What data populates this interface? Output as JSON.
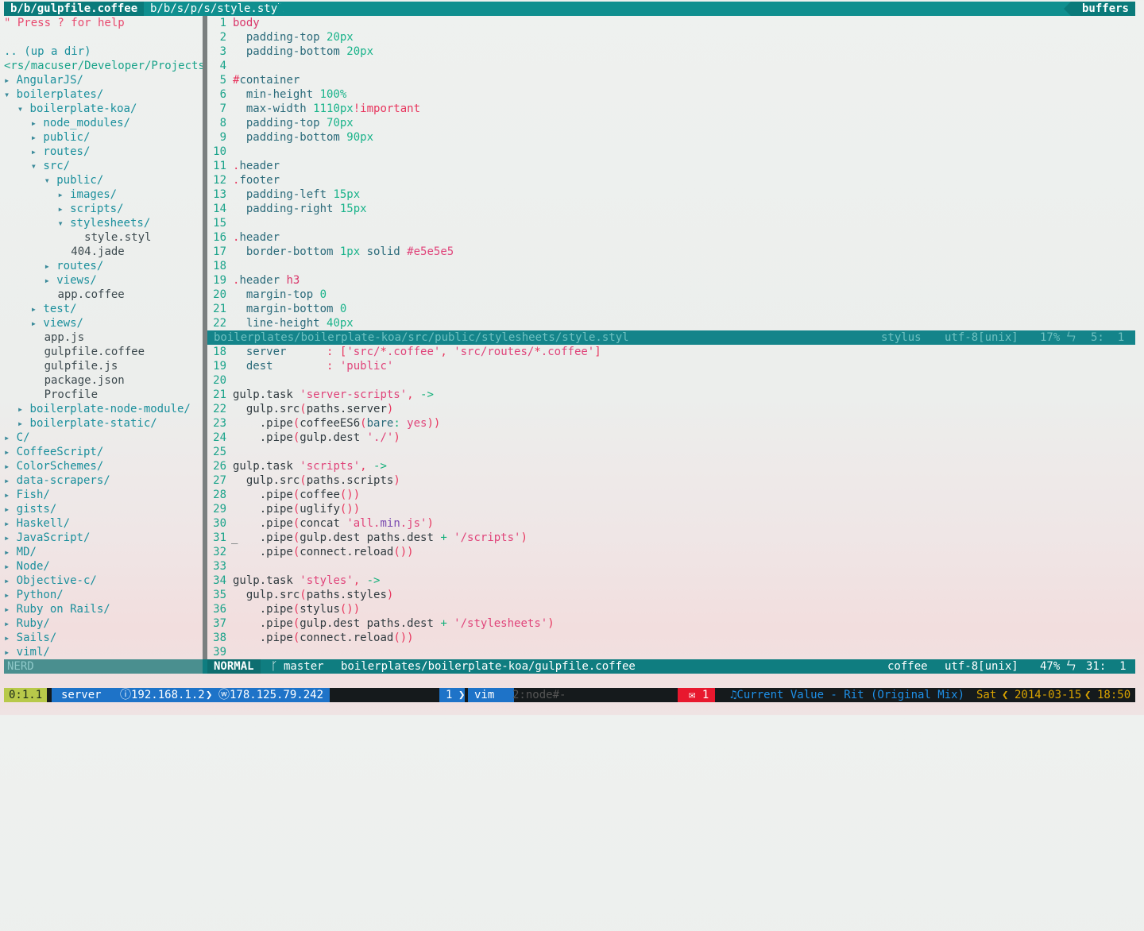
{
  "tabline": {
    "tabs": [
      {
        "label": "b/b/gulpfile.coffee",
        "active": true
      },
      {
        "label": "b/b/s/p/s/style.styl",
        "active": false
      }
    ],
    "buffers_label": "buffers"
  },
  "nerdtree": {
    "help": "\" Press ? for help",
    "up": ".. (up a dir)",
    "cwd": "<rs/macuser/Developer/Projects/",
    "entries": [
      {
        "indent": 0,
        "type": "dir-closed",
        "name": "AngularJS/"
      },
      {
        "indent": 0,
        "type": "dir-open",
        "name": "boilerplates/"
      },
      {
        "indent": 1,
        "type": "dir-open",
        "name": "boilerplate-koa/"
      },
      {
        "indent": 2,
        "type": "dir-closed",
        "name": "node_modules/"
      },
      {
        "indent": 2,
        "type": "dir-closed",
        "name": "public/"
      },
      {
        "indent": 2,
        "type": "dir-closed",
        "name": "routes/"
      },
      {
        "indent": 2,
        "type": "dir-open",
        "name": "src/"
      },
      {
        "indent": 3,
        "type": "dir-open",
        "name": "public/"
      },
      {
        "indent": 4,
        "type": "dir-closed",
        "name": "images/"
      },
      {
        "indent": 4,
        "type": "dir-closed",
        "name": "scripts/"
      },
      {
        "indent": 4,
        "type": "dir-open",
        "name": "stylesheets/"
      },
      {
        "indent": 6,
        "type": "file",
        "name": "style.styl"
      },
      {
        "indent": 5,
        "type": "file",
        "name": "404.jade"
      },
      {
        "indent": 3,
        "type": "dir-closed",
        "name": "routes/"
      },
      {
        "indent": 3,
        "type": "dir-closed",
        "name": "views/"
      },
      {
        "indent": 4,
        "type": "file",
        "name": "app.coffee"
      },
      {
        "indent": 2,
        "type": "dir-closed",
        "name": "test/"
      },
      {
        "indent": 2,
        "type": "dir-closed",
        "name": "views/"
      },
      {
        "indent": 3,
        "type": "file",
        "name": "app.js"
      },
      {
        "indent": 3,
        "type": "file",
        "name": "gulpfile.coffee"
      },
      {
        "indent": 3,
        "type": "file",
        "name": "gulpfile.js"
      },
      {
        "indent": 3,
        "type": "file",
        "name": "package.json"
      },
      {
        "indent": 3,
        "type": "file",
        "name": "Procfile"
      },
      {
        "indent": 1,
        "type": "dir-closed",
        "name": "boilerplate-node-module/"
      },
      {
        "indent": 1,
        "type": "dir-closed",
        "name": "boilerplate-static/"
      },
      {
        "indent": 0,
        "type": "dir-closed",
        "name": "C/"
      },
      {
        "indent": 0,
        "type": "dir-closed",
        "name": "CoffeeScript/"
      },
      {
        "indent": 0,
        "type": "dir-closed",
        "name": "ColorSchemes/"
      },
      {
        "indent": 0,
        "type": "dir-closed",
        "name": "data-scrapers/"
      },
      {
        "indent": 0,
        "type": "dir-closed",
        "name": "Fish/"
      },
      {
        "indent": 0,
        "type": "dir-closed",
        "name": "gists/"
      },
      {
        "indent": 0,
        "type": "dir-closed",
        "name": "Haskell/"
      },
      {
        "indent": 0,
        "type": "dir-closed",
        "name": "JavaScript/"
      },
      {
        "indent": 0,
        "type": "dir-closed",
        "name": "MD/"
      },
      {
        "indent": 0,
        "type": "dir-closed",
        "name": "Node/"
      },
      {
        "indent": 0,
        "type": "dir-closed",
        "name": "Objective-c/"
      },
      {
        "indent": 0,
        "type": "dir-closed",
        "name": "Python/"
      },
      {
        "indent": 0,
        "type": "dir-closed",
        "name": "Ruby on Rails/"
      },
      {
        "indent": 0,
        "type": "dir-closed",
        "name": "Ruby/"
      },
      {
        "indent": 0,
        "type": "dir-closed",
        "name": "Sails/"
      },
      {
        "indent": 0,
        "type": "dir-closed",
        "name": "viml/"
      }
    ],
    "status_label": "NERD"
  },
  "editor_top": {
    "lines": [
      {
        "n": "1",
        "tokens": [
          [
            "sel",
            "body"
          ]
        ]
      },
      {
        "n": "2",
        "tokens": [
          [
            "txt",
            "  "
          ],
          [
            "kw",
            "padding-top "
          ],
          [
            "num",
            "20px"
          ]
        ]
      },
      {
        "n": "3",
        "tokens": [
          [
            "txt",
            "  "
          ],
          [
            "kw",
            "padding-bottom "
          ],
          [
            "num",
            "20px"
          ]
        ]
      },
      {
        "n": "4",
        "tokens": []
      },
      {
        "n": "5",
        "tokens": [
          [
            "red",
            "#"
          ],
          [
            "kw",
            "container"
          ]
        ]
      },
      {
        "n": "6",
        "tokens": [
          [
            "txt",
            "  "
          ],
          [
            "kw",
            "min-height "
          ],
          [
            "num",
            "100%"
          ]
        ]
      },
      {
        "n": "7",
        "tokens": [
          [
            "txt",
            "  "
          ],
          [
            "kw",
            "max-width "
          ],
          [
            "num",
            "1110px"
          ],
          [
            "red",
            "!important"
          ]
        ]
      },
      {
        "n": "8",
        "tokens": [
          [
            "txt",
            "  "
          ],
          [
            "kw",
            "padding-top "
          ],
          [
            "num",
            "70px"
          ]
        ]
      },
      {
        "n": "9",
        "tokens": [
          [
            "txt",
            "  "
          ],
          [
            "kw",
            "padding-bottom "
          ],
          [
            "num",
            "90px"
          ]
        ]
      },
      {
        "n": "10",
        "tokens": []
      },
      {
        "n": "11",
        "tokens": [
          [
            "red",
            "."
          ],
          [
            "kw",
            "header"
          ]
        ]
      },
      {
        "n": "12",
        "tokens": [
          [
            "red",
            "."
          ],
          [
            "kw",
            "footer"
          ]
        ]
      },
      {
        "n": "13",
        "tokens": [
          [
            "txt",
            "  "
          ],
          [
            "kw",
            "padding-left "
          ],
          [
            "num",
            "15px"
          ]
        ]
      },
      {
        "n": "14",
        "tokens": [
          [
            "txt",
            "  "
          ],
          [
            "kw",
            "padding-right "
          ],
          [
            "num",
            "15px"
          ]
        ]
      },
      {
        "n": "15",
        "tokens": []
      },
      {
        "n": "16",
        "tokens": [
          [
            "red",
            "."
          ],
          [
            "kw",
            "header"
          ]
        ]
      },
      {
        "n": "17",
        "tokens": [
          [
            "txt",
            "  "
          ],
          [
            "kw",
            "border-bottom "
          ],
          [
            "num",
            "1px "
          ],
          [
            "kw",
            "solid "
          ],
          [
            "str",
            "#e5e5e5"
          ]
        ]
      },
      {
        "n": "18",
        "tokens": []
      },
      {
        "n": "19",
        "tokens": [
          [
            "red",
            "."
          ],
          [
            "kw",
            "header "
          ],
          [
            "sel",
            "h3"
          ]
        ]
      },
      {
        "n": "20",
        "tokens": [
          [
            "txt",
            "  "
          ],
          [
            "kw",
            "margin-top "
          ],
          [
            "num",
            "0"
          ]
        ]
      },
      {
        "n": "21",
        "tokens": [
          [
            "txt",
            "  "
          ],
          [
            "kw",
            "margin-bottom "
          ],
          [
            "num",
            "0"
          ]
        ]
      },
      {
        "n": "22",
        "tokens": [
          [
            "txt",
            "  "
          ],
          [
            "kw",
            "line-height "
          ],
          [
            "num",
            "40px"
          ]
        ]
      }
    ]
  },
  "status_inactive": {
    "path": "boilerplates/boilerplate-koa/src/public/stylesheets/style.styl",
    "filetype": "stylus",
    "encoding": "utf-8[unix]",
    "percent": "17%",
    "line_icon": "ㄣ",
    "position": "5:  1"
  },
  "editor_bottom": {
    "lines": [
      {
        "n": "18",
        "tokens": [
          [
            "txt",
            "  "
          ],
          [
            "kw",
            "server      "
          ],
          [
            "red",
            ": ["
          ],
          [
            "str",
            "'src/"
          ],
          [
            "red",
            "*"
          ],
          [
            "str",
            ".coffee'"
          ],
          [
            "red",
            ", "
          ],
          [
            "str",
            "'src/routes/"
          ],
          [
            "red",
            "*"
          ],
          [
            "str",
            ".coffee'"
          ],
          [
            "red",
            "]"
          ]
        ]
      },
      {
        "n": "19",
        "tokens": [
          [
            "txt",
            "  "
          ],
          [
            "kw",
            "dest        "
          ],
          [
            "red",
            ": "
          ],
          [
            "str",
            "'public'"
          ]
        ]
      },
      {
        "n": "20",
        "tokens": []
      },
      {
        "n": "21",
        "tokens": [
          [
            "txt",
            "gulp.task "
          ],
          [
            "str",
            "'server-scripts'"
          ],
          [
            "red",
            ", "
          ],
          [
            "grn",
            "->"
          ]
        ]
      },
      {
        "n": "22",
        "tokens": [
          [
            "txt",
            "  gulp.src"
          ],
          [
            "red",
            "("
          ],
          [
            "txt",
            "paths.server"
          ],
          [
            "red",
            ")"
          ]
        ]
      },
      {
        "n": "23",
        "tokens": [
          [
            "txt",
            "    .pipe"
          ],
          [
            "red",
            "("
          ],
          [
            "txt",
            "coffeeES6"
          ],
          [
            "red",
            "("
          ],
          [
            "kw",
            "bare"
          ],
          [
            "grn",
            ": "
          ],
          [
            "str",
            "yes"
          ],
          [
            "red",
            "))"
          ]
        ]
      },
      {
        "n": "24",
        "tokens": [
          [
            "txt",
            "    .pipe"
          ],
          [
            "red",
            "("
          ],
          [
            "txt",
            "gulp.dest "
          ],
          [
            "str",
            "'./'"
          ],
          [
            "red",
            ")"
          ]
        ]
      },
      {
        "n": "25",
        "tokens": []
      },
      {
        "n": "26",
        "tokens": [
          [
            "txt",
            "gulp.task "
          ],
          [
            "str",
            "'scripts'"
          ],
          [
            "red",
            ", "
          ],
          [
            "grn",
            "->"
          ]
        ]
      },
      {
        "n": "27",
        "tokens": [
          [
            "txt",
            "  gulp.src"
          ],
          [
            "red",
            "("
          ],
          [
            "txt",
            "paths.scripts"
          ],
          [
            "red",
            ")"
          ]
        ]
      },
      {
        "n": "28",
        "tokens": [
          [
            "txt",
            "    .pipe"
          ],
          [
            "red",
            "("
          ],
          [
            "txt",
            "coffee"
          ],
          [
            "red",
            "())"
          ]
        ]
      },
      {
        "n": "29",
        "tokens": [
          [
            "txt",
            "    .pipe"
          ],
          [
            "red",
            "("
          ],
          [
            "txt",
            "uglify"
          ],
          [
            "red",
            "())"
          ]
        ]
      },
      {
        "n": "30",
        "tokens": [
          [
            "txt",
            "    .pipe"
          ],
          [
            "red",
            "("
          ],
          [
            "txt",
            "concat "
          ],
          [
            "str",
            "'all."
          ],
          [
            "purp",
            "min"
          ],
          [
            "str",
            ".js'"
          ],
          [
            "red",
            ")"
          ]
        ]
      },
      {
        "n": "31",
        "tokens": [
          [
            "txt",
            "    .pipe"
          ],
          [
            "red",
            "("
          ],
          [
            "txt",
            "gulp.dest paths.dest "
          ],
          [
            "grn",
            "+ "
          ],
          [
            "str",
            "'/scripts'"
          ],
          [
            "red",
            ")"
          ]
        ]
      },
      {
        "n": "32",
        "tokens": [
          [
            "txt",
            "    .pipe"
          ],
          [
            "red",
            "("
          ],
          [
            "txt",
            "connect.reload"
          ],
          [
            "red",
            "())"
          ]
        ]
      },
      {
        "n": "33",
        "tokens": []
      },
      {
        "n": "34",
        "tokens": [
          [
            "txt",
            "gulp.task "
          ],
          [
            "str",
            "'styles'"
          ],
          [
            "red",
            ", "
          ],
          [
            "grn",
            "->"
          ]
        ]
      },
      {
        "n": "35",
        "tokens": [
          [
            "txt",
            "  gulp.src"
          ],
          [
            "red",
            "("
          ],
          [
            "txt",
            "paths.styles"
          ],
          [
            "red",
            ")"
          ]
        ]
      },
      {
        "n": "36",
        "tokens": [
          [
            "txt",
            "    .pipe"
          ],
          [
            "red",
            "("
          ],
          [
            "txt",
            "stylus"
          ],
          [
            "red",
            "())"
          ]
        ]
      },
      {
        "n": "37",
        "tokens": [
          [
            "txt",
            "    .pipe"
          ],
          [
            "red",
            "("
          ],
          [
            "txt",
            "gulp.dest paths.dest "
          ],
          [
            "grn",
            "+ "
          ],
          [
            "str",
            "'/stylesheets'"
          ],
          [
            "red",
            ")"
          ]
        ]
      },
      {
        "n": "38",
        "tokens": [
          [
            "txt",
            "    .pipe"
          ],
          [
            "red",
            "("
          ],
          [
            "txt",
            "connect.reload"
          ],
          [
            "red",
            "())"
          ]
        ]
      },
      {
        "n": "39",
        "tokens": []
      }
    ],
    "cursor_marker": "_"
  },
  "status_active": {
    "mode": "NORMAL",
    "branch_icon": "ᚴ",
    "branch": "master",
    "path": "boilerplates/boilerplate-koa/gulpfile.coffee",
    "filetype": "coffee",
    "encoding": "utf-8[unix]",
    "percent": "47%",
    "line_icon": "ㄣ",
    "position": "31:  1"
  },
  "tmux": {
    "session": "0:1.1",
    "host": "server",
    "local_ip": "ⓘ192.168.1.2",
    "wan_ip": "ⓦ178.125.79.242",
    "window_index": "1",
    "window_name": "vim",
    "other_window": "2:node#-",
    "mail": "✉ 1",
    "music": "♫Current Value - Rit (Original Mix)",
    "day": "Sat",
    "date": "2014-03-15",
    "time": "18:50"
  }
}
